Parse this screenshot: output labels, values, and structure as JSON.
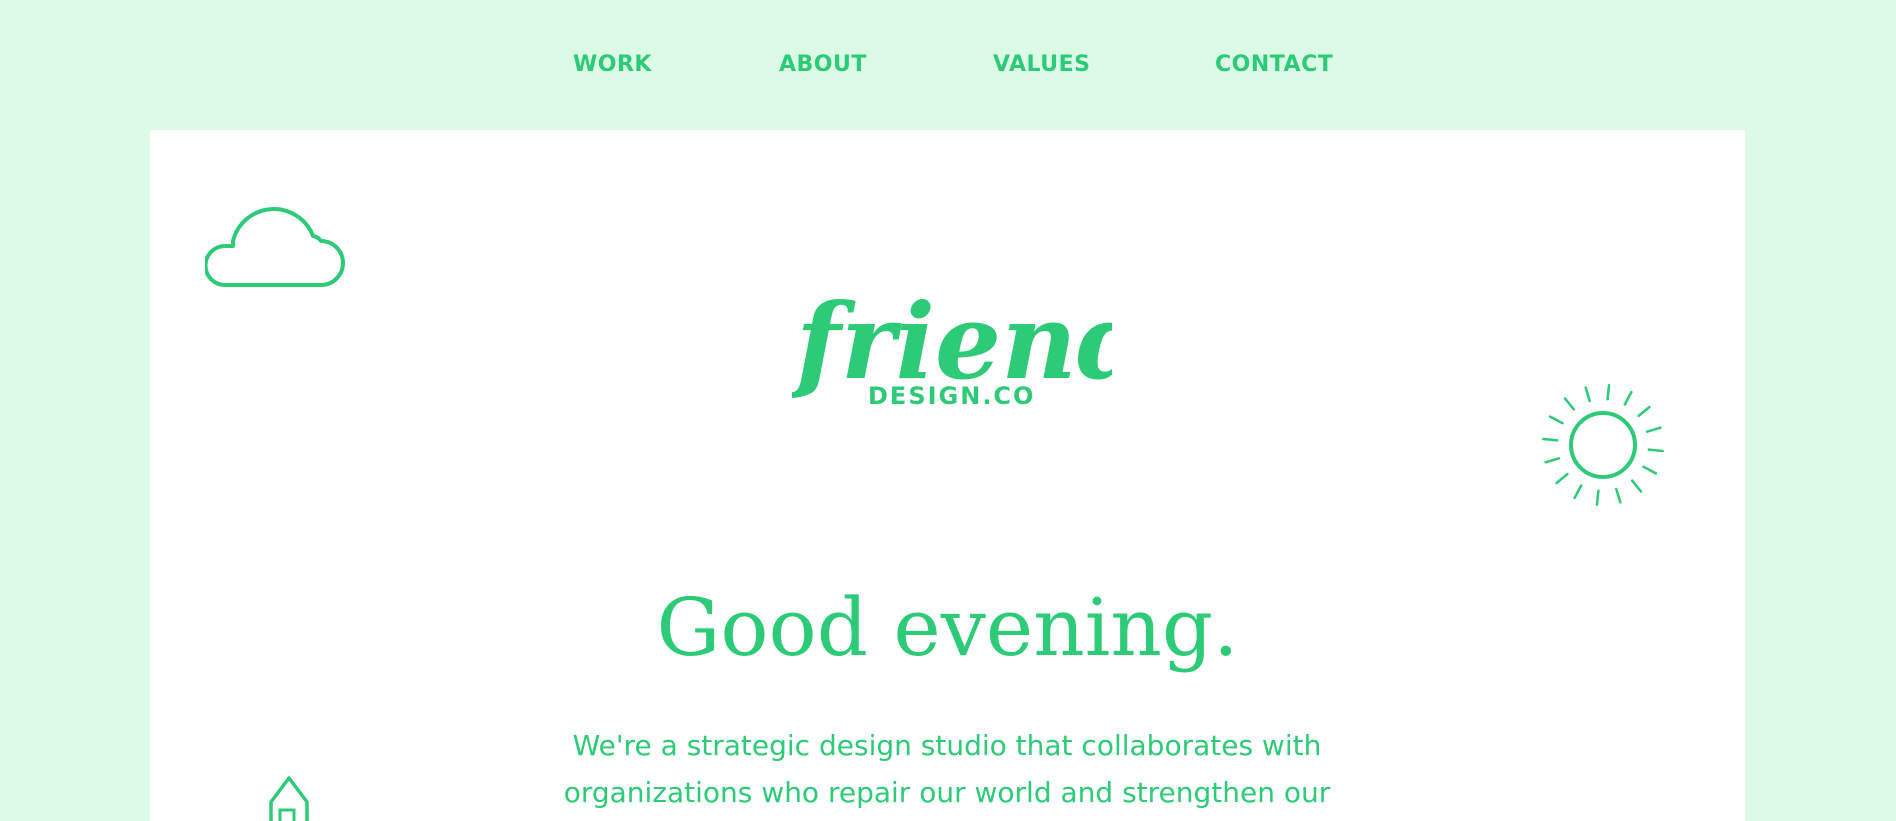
{
  "nav": {
    "items": [
      {
        "label": "WORK"
      },
      {
        "label": "ABOUT"
      },
      {
        "label": "VALUES"
      },
      {
        "label": "CONTACT"
      }
    ]
  },
  "logo": {
    "script": "friendly",
    "sub": "DESIGN.CO"
  },
  "hero": {
    "headline": "Good evening.",
    "intro": "We're a strategic design studio that collaborates with organizations who repair our world and strengthen our"
  },
  "icons": {
    "cloud": "cloud-icon",
    "sun": "sun-icon",
    "house": "house-icon"
  },
  "colors": {
    "accent": "#2dcb77",
    "background": "#dcfbe7",
    "card": "#ffffff"
  }
}
